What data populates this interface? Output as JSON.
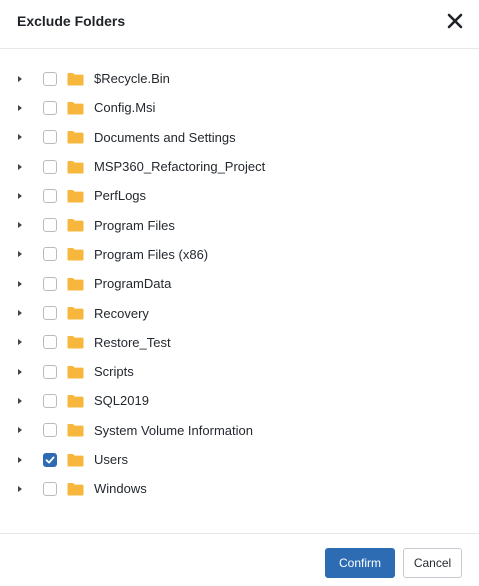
{
  "dialog": {
    "title": "Exclude Folders",
    "close_icon": "close-icon"
  },
  "folders": [
    {
      "label": "$Recycle.Bin",
      "checked": false
    },
    {
      "label": "Config.Msi",
      "checked": false
    },
    {
      "label": "Documents and Settings",
      "checked": false
    },
    {
      "label": "MSP360_Refactoring_Project",
      "checked": false
    },
    {
      "label": "PerfLogs",
      "checked": false
    },
    {
      "label": "Program Files",
      "checked": false
    },
    {
      "label": "Program Files (x86)",
      "checked": false
    },
    {
      "label": "ProgramData",
      "checked": false
    },
    {
      "label": "Recovery",
      "checked": false
    },
    {
      "label": "Restore_Test",
      "checked": false
    },
    {
      "label": "Scripts",
      "checked": false
    },
    {
      "label": "SQL2019",
      "checked": false
    },
    {
      "label": "System Volume Information",
      "checked": false
    },
    {
      "label": "Users",
      "checked": true
    },
    {
      "label": "Windows",
      "checked": false
    }
  ],
  "footer": {
    "confirm_label": "Confirm",
    "cancel_label": "Cancel"
  },
  "colors": {
    "accent": "#2d6cb3",
    "folder": "#f6b73c"
  }
}
